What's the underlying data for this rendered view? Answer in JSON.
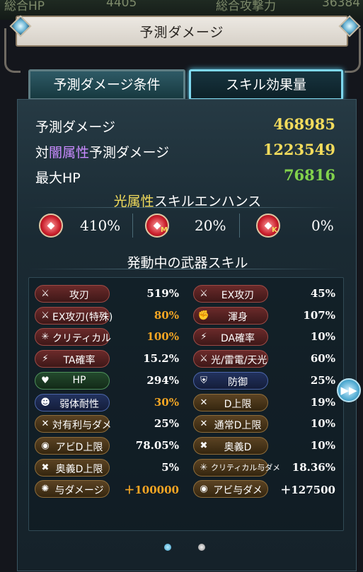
{
  "background": {
    "left_text": "総合HP",
    "left_value": "4405",
    "right_text": "総合攻撃力",
    "right_value": "36384"
  },
  "window": {
    "title": "予測ダメージ"
  },
  "tabs": [
    {
      "label": "予測ダメージ条件",
      "active": false
    },
    {
      "label": "スキル効果量",
      "active": true
    }
  ],
  "summary": {
    "predicted_damage_label": "予測ダメージ",
    "predicted_damage_value": "468985",
    "vs_prefix": "対",
    "vs_element": "闇属性",
    "vs_suffix": "予測ダメージ",
    "vs_value": "1223549",
    "max_hp_label": "最大HP",
    "max_hp_value": "76816"
  },
  "enhance": {
    "title_element": "光属性",
    "title_rest": "スキルエンハンス",
    "items": [
      {
        "icon": "light-skill-icon",
        "sub": "",
        "value": "410%"
      },
      {
        "icon": "light-skill-m-icon",
        "sub": "M",
        "value": "20%"
      },
      {
        "icon": "light-skill-k-icon",
        "sub": "K",
        "value": "0%"
      }
    ]
  },
  "weapon_skills": {
    "title": "発動中の武器スキル",
    "left": [
      {
        "label": "攻刃",
        "value": "519%",
        "style": "red",
        "icon": "sword-icon",
        "highlight": false
      },
      {
        "label": "EX攻刃(特殊)",
        "value": "80%",
        "style": "red",
        "icon": "sword-icon",
        "highlight": true
      },
      {
        "label": "クリティカル",
        "value": "100%",
        "style": "red",
        "icon": "burst-icon",
        "highlight": true
      },
      {
        "label": "TA確率",
        "value": "15.2%",
        "style": "red",
        "icon": "slash-icon",
        "highlight": false
      },
      {
        "label": "HP",
        "value": "294%",
        "style": "grn",
        "icon": "heart-icon",
        "highlight": false
      },
      {
        "label": "弱体耐性",
        "value": "30%",
        "style": "blu",
        "icon": "person-icon",
        "highlight": true
      },
      {
        "label": "対有利与ダメ",
        "value": "25%",
        "style": "brn",
        "icon": "swords-icon",
        "highlight": false
      },
      {
        "label": "アビD上限",
        "value": "78.05%",
        "style": "brn",
        "icon": "ab-icon",
        "highlight": false
      },
      {
        "label": "奥義D上限",
        "value": "5%",
        "style": "brn",
        "icon": "cross-icon",
        "highlight": false
      },
      {
        "label": "与ダメージ",
        "value": "＋100000",
        "style": "brn",
        "icon": "gear-icon",
        "highlight": true
      }
    ],
    "right": [
      {
        "label": "EX攻刃",
        "value": "45%",
        "style": "red",
        "icon": "sword-icon",
        "highlight": false
      },
      {
        "label": "渾身",
        "value": "107%",
        "style": "red",
        "icon": "arm-icon",
        "highlight": false
      },
      {
        "label": "DA確率",
        "value": "10%",
        "style": "red",
        "icon": "slash-icon",
        "highlight": false
      },
      {
        "label": "光/雷電/天光",
        "value": "60%",
        "style": "red",
        "icon": "sword-icon",
        "highlight": false
      },
      {
        "label": "防御",
        "value": "25%",
        "style": "blu",
        "icon": "shield-icon",
        "highlight": false
      },
      {
        "label": "D上限",
        "value": "19%",
        "style": "brn",
        "icon": "swords-icon",
        "highlight": false
      },
      {
        "label": "通常D上限",
        "value": "10%",
        "style": "brn",
        "icon": "swords-icon",
        "highlight": false
      },
      {
        "label": "奥義D",
        "value": "10%",
        "style": "brn",
        "icon": "cross-icon",
        "highlight": false
      },
      {
        "label": "クリティカル与ダメ",
        "value": "18.36%",
        "style": "brn",
        "icon": "burst-icon",
        "highlight": false
      },
      {
        "label": "アビ与ダメ",
        "value": "＋127500",
        "style": "brn",
        "icon": "ab-icon",
        "highlight": false
      }
    ]
  },
  "pager": {
    "pages": 2,
    "current": 1
  },
  "colors": {
    "accent": "#7ed8ee",
    "damage": "#f3dc5c",
    "hp": "#82d24c",
    "element": "#c98bff",
    "highlight": "#f5a623"
  }
}
